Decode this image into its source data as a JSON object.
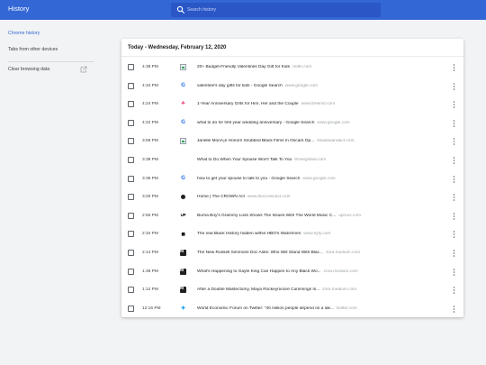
{
  "app": {
    "title": "History"
  },
  "search": {
    "placeholder": "Search history"
  },
  "sidebar": {
    "items": [
      {
        "label": "Chrome history",
        "selected": true
      },
      {
        "label": "Tabs from other devices",
        "selected": false
      },
      {
        "label": "Clear browsing data",
        "selected": false
      }
    ]
  },
  "history": {
    "header": "Today - Wednesday, February 12, 2020",
    "entries": [
      {
        "time": "4:38 PM",
        "title": "20+ Budget-Friendly Valentines Day Gift for Kids",
        "domain": "redtri.com",
        "icon": "image-favicon-icon"
      },
      {
        "time": "4:34 PM",
        "title": "valentine's day gifts for kids - Google Search",
        "domain": "www.google.com",
        "icon": "google-icon"
      },
      {
        "time": "4:24 PM",
        "title": "1-Year Anniversary Gifts for Him, Her and the Couple",
        "domain": "www.theknot.com",
        "icon": "theknot-icon"
      },
      {
        "time": "4:22 PM",
        "title": "what to do for first year wedding anniversary - Google Search",
        "domain": "www.google.com",
        "icon": "google-icon"
      },
      {
        "time": "3:59 PM",
        "title": "Janelle MonÃ¡e Honors Snubbed Black Films In Oscars Op...",
        "domain": "shadowandact.com",
        "icon": "image-favicon-icon"
      },
      {
        "time": "3:38 PM",
        "title": "What to Do When Your Spouse Won't Talk To You",
        "domain": "thriveglobal.com",
        "icon": "blank-icon"
      },
      {
        "time": "3:35 PM",
        "title": "how to get your spouse to talk to you - Google Search",
        "domain": "www.google.com",
        "icon": "google-icon"
      },
      {
        "time": "3:20 PM",
        "title": "Home | The CROWN Act",
        "domain": "www.thecrownact.com",
        "icon": "crown-act-icon"
      },
      {
        "time": "2:55 PM",
        "title": "Burna Boy's Grammy Loss Shows The Issues With The World Music C...",
        "domain": "uproxx.com",
        "icon": "uproxx-icon"
      },
      {
        "time": "2:34 PM",
        "title": "The real Black History hidden within HBO's Watchmen",
        "domain": "www.syfy.com",
        "icon": "syfy-icon"
      },
      {
        "time": "2:14 PM",
        "title": "The New Russell Simmons Doc Asks: Who Will Stand With Blac...",
        "domain": "zora.medium.com",
        "icon": "medium-icon"
      },
      {
        "time": "1:36 PM",
        "title": "What's Happening to Gayle King Can Happen to Any Black Wo...",
        "domain": "zora.medium.com",
        "icon": "medium-icon"
      },
      {
        "time": "1:12 PM",
        "title": "After a Double Mastectomy, Maya Rockeymoore Cummings Is...",
        "domain": "zora.medium.com",
        "icon": "medium-icon"
      },
      {
        "time": "12:15 PM",
        "title": "World Economic Forum on Twitter: \"40 million people depend on a lak...",
        "domain": "twitter.com",
        "icon": "twitter-icon"
      }
    ]
  },
  "colors": {
    "accent": "#3367d6",
    "header_bg": "#3367d6",
    "search_bg": "#2a56c6",
    "page_bg": "#f1f3f4"
  }
}
